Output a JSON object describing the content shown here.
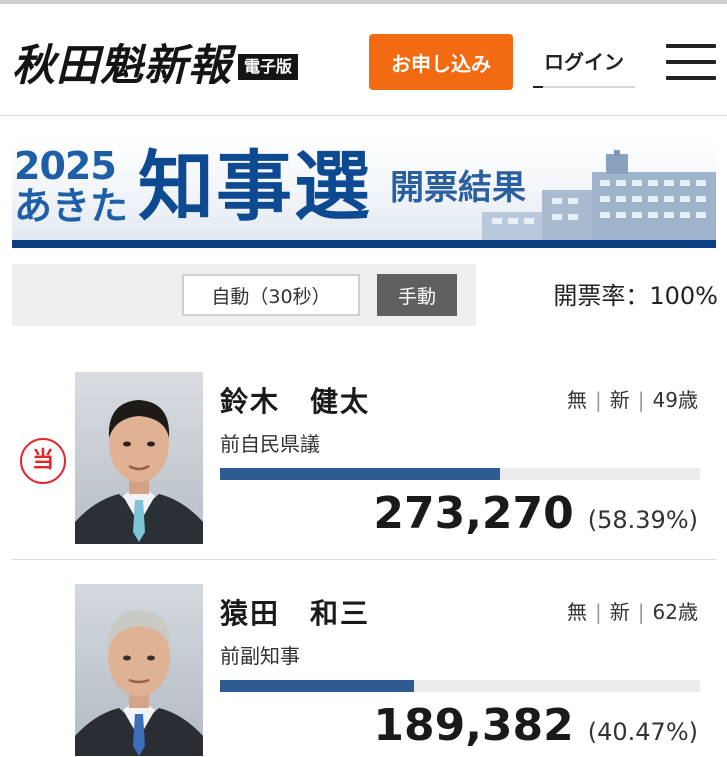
{
  "header": {
    "logo_text": "秋田魁新報",
    "logo_badge": "電子版",
    "apply_label": "お申し込み",
    "login_label": "ログイン"
  },
  "banner": {
    "year": "2025",
    "place": "あきた",
    "title": "知事選",
    "subtitle": "開票結果"
  },
  "controls": {
    "auto_label": "自動（30秒）",
    "manual_label": "手動",
    "rate_label": "開票率：100%"
  },
  "candidates": [
    {
      "winner_mark": "当",
      "name": "鈴木　健太",
      "affiliation": "無",
      "status": "新",
      "age": "49歳",
      "position": "前自民県議",
      "votes": "273,270",
      "percent_label": "(58.39%)",
      "share": 58.39
    },
    {
      "name": "猿田　和三",
      "affiliation": "無",
      "status": "新",
      "age": "62歳",
      "position": "前副知事",
      "votes": "189,382",
      "percent_label": "(40.47%)",
      "share": 40.47
    }
  ],
  "colors": {
    "accent_orange": "#f26a12",
    "bar_blue": "#2e5c92",
    "winner_red": "#e3262b",
    "banner_navy": "#0b3f80"
  },
  "icons": {
    "menu": "hamburger-menu-icon",
    "winner": "winner-mark-icon"
  }
}
